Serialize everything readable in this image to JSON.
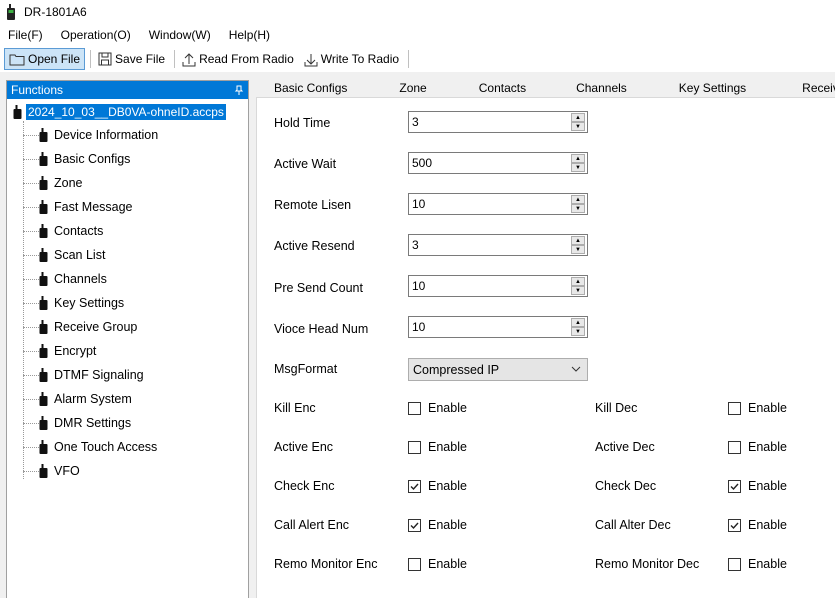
{
  "window": {
    "title": "DR-1801A6"
  },
  "menu": [
    "File(F)",
    "Operation(O)",
    "Window(W)",
    "Help(H)"
  ],
  "toolbar": {
    "open_file": "Open File",
    "save_file": "Save File",
    "read_from_radio": "Read From Radio",
    "write_to_radio": "Write To Radio"
  },
  "functions_panel": {
    "header": "Functions",
    "root": "2024_10_03__DB0VA-ohneID.accps",
    "items": [
      "Device Information",
      "Basic Configs",
      "Zone",
      "Fast Message",
      "Contacts",
      "Scan List",
      "Channels",
      "Key Settings",
      "Receive Group",
      "Encrypt",
      "DTMF Signaling",
      "Alarm System",
      "DMR Settings",
      "One Touch Access",
      "VFO"
    ]
  },
  "tabs": [
    "Basic Configs",
    "Zone",
    "Contacts",
    "Channels",
    "Key Settings",
    "Receive"
  ],
  "form": {
    "hold_time": {
      "label": "Hold Time",
      "value": "3"
    },
    "active_wait": {
      "label": "Active Wait",
      "value": "500"
    },
    "remote_lisen": {
      "label": "Remote Lisen",
      "value": "10"
    },
    "active_resend": {
      "label": "Active Resend",
      "value": "3"
    },
    "pre_send_count": {
      "label": "Pre Send Count",
      "value": "10"
    },
    "vioce_head_num": {
      "label": "Vioce Head Num",
      "value": "10"
    },
    "msg_format": {
      "label": "MsgFormat",
      "value": "Compressed IP"
    },
    "enable_text": "Enable",
    "checks": [
      {
        "left_label": "Kill Enc",
        "left_checked": false,
        "right_label": "Kill Dec",
        "right_checked": false
      },
      {
        "left_label": "Active Enc",
        "left_checked": false,
        "right_label": "Active Dec",
        "right_checked": false
      },
      {
        "left_label": "Check Enc",
        "left_checked": true,
        "right_label": "Check Dec",
        "right_checked": true
      },
      {
        "left_label": "Call Alert Enc",
        "left_checked": true,
        "right_label": "Call Alter Dec",
        "right_checked": true
      },
      {
        "left_label": "Remo Monitor Enc",
        "left_checked": false,
        "right_label": "Remo Monitor Dec",
        "right_checked": false
      }
    ]
  }
}
